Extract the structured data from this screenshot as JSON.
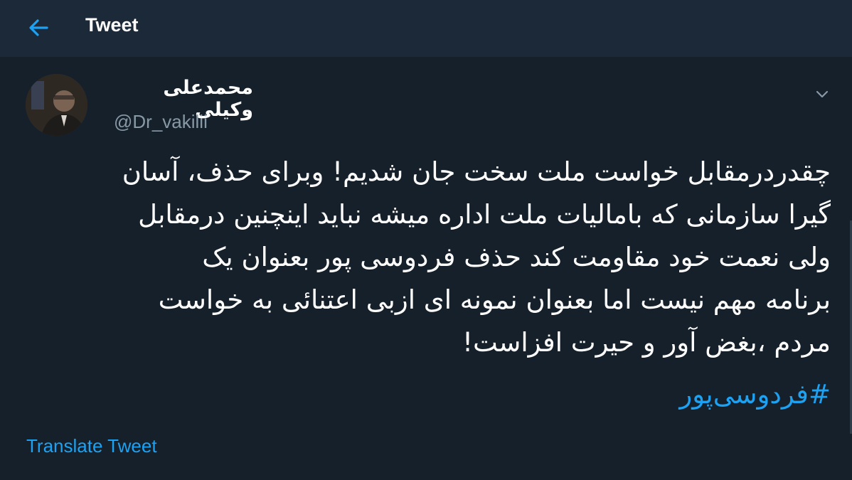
{
  "header": {
    "title": "Tweet"
  },
  "tweet": {
    "author_name": "محمدعلی وکیلی",
    "author_handle": "@Dr_vakilii",
    "lines": [
      "چقدردرمقابل خواست ملت سخت جان شدیم! وبرای حذف، آسان",
      "گیرا سازمانی که بامالیات ملت اداره میشه نباید اینچنین درمقابل",
      "ولی نعمت خود مقاومت کند حذف فردوسی پور بعنوان یک",
      "برنامه مهم نیست اما بعنوان نمونه ای ازبی اعتنائی به خواست",
      "مردم ،بغض آور و حیرت افزاست!"
    ],
    "hashtag": "#فردوسی‌پور",
    "translate_label": "Translate Tweet"
  },
  "icons": {
    "back": "arrow-left-icon",
    "caret": "chevron-down-icon"
  },
  "colors": {
    "background": "#15202b",
    "header_background": "#1c2938",
    "accent": "#1da1f2",
    "secondary_text": "#8899a6"
  }
}
